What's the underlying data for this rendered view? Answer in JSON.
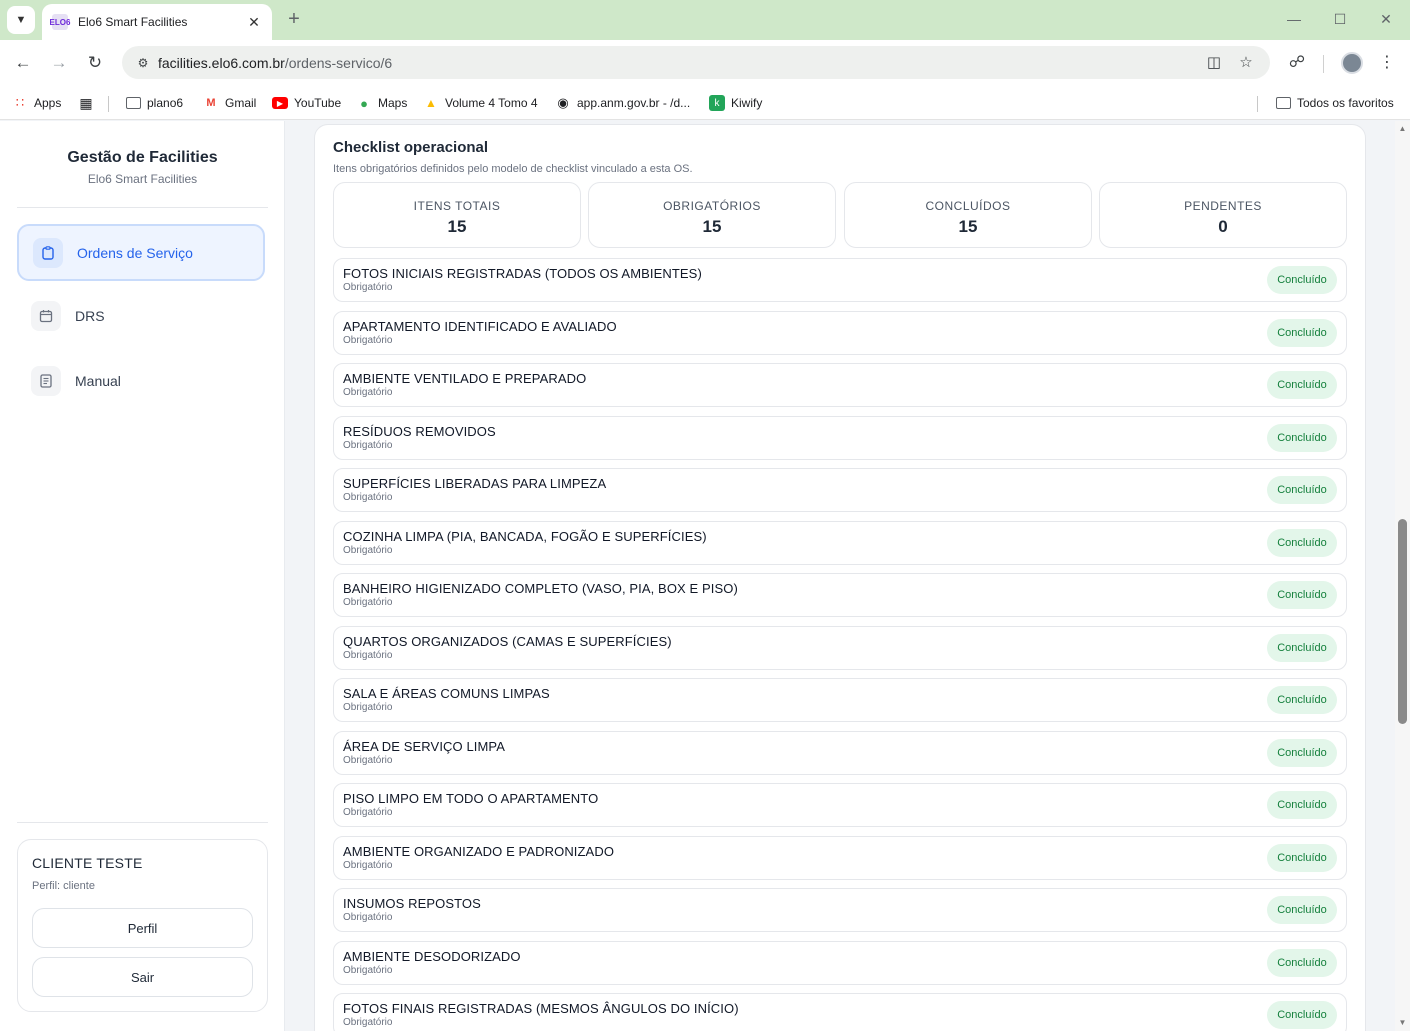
{
  "browser": {
    "tab_title": "Elo6 Smart Facilities",
    "tab_favicon": "ELO6",
    "url_host": "facilities.elo6.com.br",
    "url_path": "/ordens-servico/6",
    "bookmarks": [
      {
        "label": "Apps",
        "icon": "apps-grid-icon"
      },
      {
        "label": "plano6",
        "icon": "folder-icon"
      },
      {
        "label": "Gmail",
        "icon": "gmail-icon"
      },
      {
        "label": "YouTube",
        "icon": "youtube-icon"
      },
      {
        "label": "Maps",
        "icon": "maps-icon"
      },
      {
        "label": "Volume 4 Tomo 4",
        "icon": "drive-icon"
      },
      {
        "label": "app.anm.gov.br - /d...",
        "icon": "globe-icon"
      },
      {
        "label": "Kiwify",
        "icon": "kiwify-icon"
      }
    ],
    "all_bookmarks": "Todos os favoritos"
  },
  "sidebar": {
    "title": "Gestão de Facilities",
    "subtitle": "Elo6 Smart Facilities",
    "nav": [
      {
        "label": "Ordens de Serviço",
        "active": true
      },
      {
        "label": "DRS",
        "active": false
      },
      {
        "label": "Manual",
        "active": false
      }
    ],
    "user": {
      "name": "CLIENTE TESTE",
      "role": "Perfil: cliente",
      "profile_button": "Perfil",
      "logout_button": "Sair"
    }
  },
  "checklist": {
    "title": "Checklist operacional",
    "description": "Itens obrigatórios definidos pelo modelo de checklist vinculado a esta OS.",
    "stats": [
      {
        "label": "ITENS TOTAIS",
        "value": "15"
      },
      {
        "label": "OBRIGATÓRIOS",
        "value": "15"
      },
      {
        "label": "CONCLUÍDOS",
        "value": "15"
      },
      {
        "label": "PENDENTES",
        "value": "0"
      }
    ],
    "items": [
      {
        "title": "FOTOS INICIAIS REGISTRADAS (TODOS OS AMBIENTES)",
        "subtitle": "Obrigatório",
        "status": "Concluído"
      },
      {
        "title": "APARTAMENTO IDENTIFICADO E AVALIADO",
        "subtitle": "Obrigatório",
        "status": "Concluído"
      },
      {
        "title": "AMBIENTE VENTILADO E PREPARADO",
        "subtitle": "Obrigatório",
        "status": "Concluído"
      },
      {
        "title": "RESÍDUOS REMOVIDOS",
        "subtitle": "Obrigatório",
        "status": "Concluído"
      },
      {
        "title": "SUPERFÍCIES LIBERADAS PARA LIMPEZA",
        "subtitle": "Obrigatório",
        "status": "Concluído"
      },
      {
        "title": "COZINHA LIMPA (PIA, BANCADA, FOGÃO E SUPERFÍCIES)",
        "subtitle": "Obrigatório",
        "status": "Concluído"
      },
      {
        "title": "BANHEIRO HIGIENIZADO COMPLETO (VASO, PIA, BOX E PISO)",
        "subtitle": "Obrigatório",
        "status": "Concluído"
      },
      {
        "title": "QUARTOS ORGANIZADOS (CAMAS E SUPERFÍCIES)",
        "subtitle": "Obrigatório",
        "status": "Concluído"
      },
      {
        "title": "SALA E ÁREAS COMUNS LIMPAS",
        "subtitle": "Obrigatório",
        "status": "Concluído"
      },
      {
        "title": "ÁREA DE SERVIÇO LIMPA",
        "subtitle": "Obrigatório",
        "status": "Concluído"
      },
      {
        "title": "PISO LIMPO EM TODO O APARTAMENTO",
        "subtitle": "Obrigatório",
        "status": "Concluído"
      },
      {
        "title": "AMBIENTE ORGANIZADO E PADRONIZADO",
        "subtitle": "Obrigatório",
        "status": "Concluído"
      },
      {
        "title": "INSUMOS REPOSTOS",
        "subtitle": "Obrigatório",
        "status": "Concluído"
      },
      {
        "title": "AMBIENTE DESODORIZADO",
        "subtitle": "Obrigatório",
        "status": "Concluído"
      },
      {
        "title": "FOTOS FINAIS REGISTRADAS (MESMOS ÂNGULOS DO INÍCIO)",
        "subtitle": "Obrigatório",
        "status": "Concluído"
      }
    ]
  },
  "colors": {
    "accent": "#2563eb",
    "success_bg": "#e3f6ea",
    "success_text": "#15803d",
    "tabstrip": "#cfe8c9"
  }
}
